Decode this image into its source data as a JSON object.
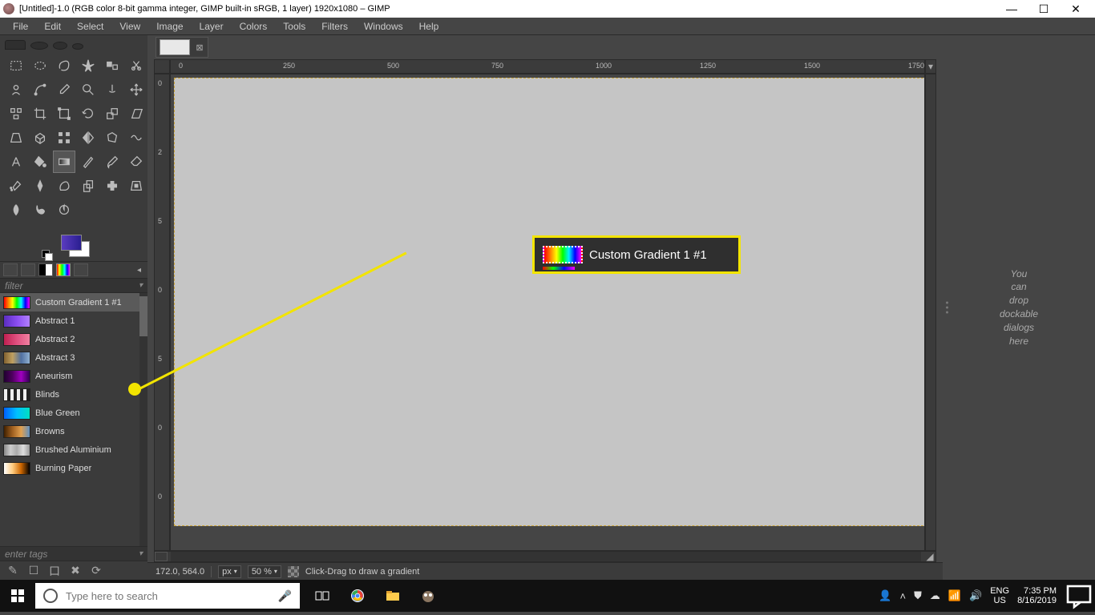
{
  "title": "[Untitled]-1.0 (RGB color 8-bit gamma integer, GIMP built-in sRGB, 1 layer) 1920x1080 – GIMP",
  "menu": [
    "File",
    "Edit",
    "Select",
    "View",
    "Image",
    "Layer",
    "Colors",
    "Tools",
    "Filters",
    "Windows",
    "Help"
  ],
  "ruler_h": [
    "0",
    "250",
    "500",
    "750",
    "1000",
    "1250",
    "1500",
    "1750"
  ],
  "ruler_v": [
    "0",
    "2",
    "5",
    "0",
    "5",
    "0",
    "0"
  ],
  "filter_label": "filter",
  "gradients": [
    {
      "label": "Custom Gradient 1 #1",
      "cls": "g-custom",
      "selected": true
    },
    {
      "label": "Abstract 1",
      "cls": "g-ab1"
    },
    {
      "label": "Abstract 2",
      "cls": "g-ab2"
    },
    {
      "label": "Abstract 3",
      "cls": "g-ab3"
    },
    {
      "label": "Aneurism",
      "cls": "g-aneur"
    },
    {
      "label": "Blinds",
      "cls": "g-blinds"
    },
    {
      "label": "Blue Green",
      "cls": "g-bluegreen"
    },
    {
      "label": "Browns",
      "cls": "g-browns"
    },
    {
      "label": "Brushed Aluminium",
      "cls": "g-brush"
    },
    {
      "label": "Burning Paper",
      "cls": "g-burn"
    }
  ],
  "tags_label": "enter tags",
  "right_drop": [
    "You",
    "can",
    "drop",
    "dockable",
    "dialogs",
    "here"
  ],
  "status": {
    "coords": "172.0, 564.0",
    "unit": "px",
    "zoom": "50 %",
    "hint": "Click-Drag to draw a gradient"
  },
  "callout": {
    "text": "Custom Gradient 1 #1"
  },
  "taskbar": {
    "search_placeholder": "Type here to search",
    "lang1": "ENG",
    "lang2": "US",
    "time": "7:35 PM",
    "date": "8/16/2019"
  }
}
